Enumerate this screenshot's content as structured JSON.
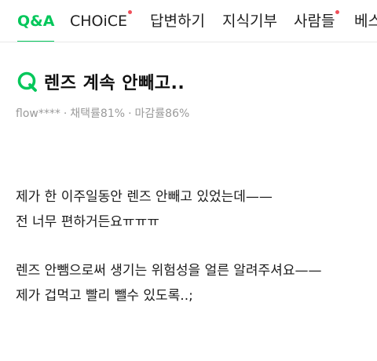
{
  "tabs": [
    {
      "label": "Q&A",
      "active": true,
      "dot": false
    },
    {
      "label": "CHOiCE",
      "active": false,
      "dot": true
    },
    {
      "label": "답변하기",
      "active": false,
      "dot": false
    },
    {
      "label": "지식기부",
      "active": false,
      "dot": false
    },
    {
      "label": "사람들",
      "active": false,
      "dot": true
    },
    {
      "label": "베스",
      "active": false,
      "dot": false
    }
  ],
  "question": {
    "title": "렌즈 계속 안빼고..",
    "author": "flow****",
    "selection_rate": "채택률81%",
    "close_rate": "마감률86%"
  },
  "body": {
    "lines": [
      "제가 한 이주일동안 렌즈 안빼고 있었는데——",
      "전 너무 편하거든요ㅠㅠㅠ",
      "렌즈 안뺌으로써 생기는 위험성을 얼른 알려주셔요——",
      "제가 겁먹고 빨리 뺄수 있도록..;"
    ]
  },
  "colors": {
    "accent": "#03c75a",
    "badge_dot": "#f0505a",
    "meta_text": "#9a9a9a"
  },
  "icons": {
    "question": "q-letter-icon"
  }
}
